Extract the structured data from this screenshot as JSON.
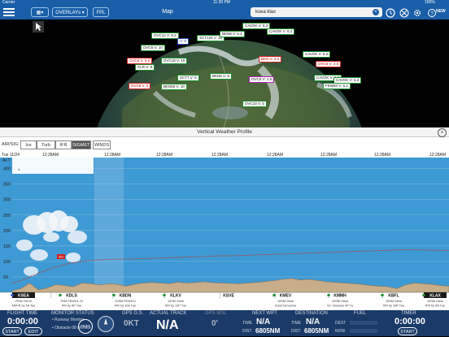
{
  "status_bar": {
    "carrier": "Carrier",
    "time": "11:30 PM",
    "battery": "100%"
  },
  "nav": {
    "overlays_label": "OVERLAYs",
    "fpl_label": "FPL",
    "title": "Map",
    "search_value": "ksea klax",
    "new_badge": "NEW"
  },
  "map": {
    "metars": [
      {
        "text": "OVC12 V: 6.2",
        "cat": "vfr"
      },
      {
        "text": "V: 8",
        "cat": "mvfr"
      },
      {
        "text": "SCT120 V: 10",
        "cat": "vfr"
      },
      {
        "text": "BKN8 V: 5.2",
        "cat": "vfr"
      },
      {
        "text": "CAVOK V: 6.2",
        "cat": "vfr"
      },
      {
        "text": "CAVOK V: 6.2",
        "cat": "vfr"
      },
      {
        "text": "OVC6 V: 10",
        "cat": "vfr"
      },
      {
        "text": "OVC6 V: 6.2",
        "cat": "ifr"
      },
      {
        "text": "OVC18 V: 15",
        "cat": "vfr"
      },
      {
        "text": "BKN V: 3.2",
        "cat": "ifr"
      },
      {
        "text": "CAVOK V: 6.2",
        "cat": "vfr"
      },
      {
        "text": "OVC5 V: 3.0",
        "cat": "ifr"
      },
      {
        "text": "CLR V: 9",
        "cat": "vfr"
      },
      {
        "text": "SCT7 V: 5",
        "cat": "vfr"
      },
      {
        "text": "CAVOK V: 6.2",
        "cat": "vfr"
      },
      {
        "text": "BKN8 V: 8",
        "cat": "vfr"
      },
      {
        "text": "OVC5 V: 1.5",
        "cat": "lifr"
      },
      {
        "text": "CAVOK V: 6.2",
        "cat": "vfr"
      },
      {
        "text": "OVC8 V: 0",
        "cat": "ifr"
      },
      {
        "text": "BKN50 V: 10",
        "cat": "vfr"
      },
      {
        "text": "FEW50 V: 6.2",
        "cat": "vfr"
      },
      {
        "text": "OVC10 V: 5",
        "cat": "vfr"
      }
    ]
  },
  "profile": {
    "title": "Vertical Weather Profile",
    "air_sig_label": "AIR/SIG:",
    "overlays": [
      "Ice",
      "Turb",
      "IFR",
      "SIGMET",
      "WINDS"
    ],
    "active_overlay": "SIGMET",
    "date_label": "Tue 11/24",
    "time_labels": [
      "12:28AM",
      "12:28AM",
      "12:28AM",
      "12:28AM",
      "12:28AM",
      "12:28AM",
      "12:28AM",
      "12:28AM"
    ],
    "alt_label": "ALT",
    "alt_ticks": [
      "400",
      "350",
      "300",
      "250",
      "200",
      "150",
      "100",
      "50"
    ],
    "alt_tick_values": [
      400,
      350,
      300,
      250,
      200,
      150,
      100,
      50
    ],
    "sigmet_marker": "SIG",
    "airports": [
      {
        "id": "KSEA",
        "l1": "FEW OVC6",
        "l2": "MVFR by 1A Tue",
        "color": "#2850d8",
        "boxed": true
      },
      {
        "id": "KDLS",
        "l1": "7NM FEW15, Ol",
        "l2": "IFR by 5P Tue",
        "color": "#1f8f2f",
        "boxed": false
      },
      {
        "id": "KBDN",
        "l1": "10SM FEW110",
        "l2": "IFR by 10A Tue",
        "color": "#1f8f2f",
        "boxed": false
      },
      {
        "id": "KLKV",
        "l1": "10SM Clear",
        "l2": "IFR by 12P Tue",
        "color": "#1f8f2f",
        "boxed": false
      },
      {
        "id": "KSVE",
        "l1": "",
        "l2": "",
        "color": "",
        "boxed": false
      },
      {
        "id": "KMEV",
        "l1": "10SM Clear",
        "l2": "Good tomorrow",
        "color": "#1f8f2f",
        "boxed": false
      },
      {
        "id": "KMMH",
        "l1": "10SM Clear",
        "l2": "VC Showers 4P Tu",
        "color": "#1f8f2f",
        "boxed": false
      },
      {
        "id": "KBFL",
        "l1": "10SM Clear",
        "l2": "IFR by 10P Tue",
        "color": "#1f8f2f",
        "boxed": false
      },
      {
        "id": "KLAX",
        "l1": "10SM Clear",
        "l2": "IFR by 5A Tue",
        "color": "#1f8f2f",
        "boxed": true
      }
    ]
  },
  "chart_data": {
    "type": "area",
    "title": "Vertical Weather Profile",
    "ylabel": "ALT",
    "ylim": [
      0,
      420
    ],
    "y_ticks": [
      50,
      100,
      150,
      200,
      250,
      300,
      350,
      400
    ],
    "x": [
      0,
      2,
      4,
      6,
      8,
      10,
      12,
      14,
      16,
      18,
      20,
      22,
      24,
      26,
      28,
      30,
      32,
      34,
      36,
      38,
      40,
      42,
      44,
      46,
      48,
      50,
      52,
      54,
      56,
      58,
      60,
      62,
      64,
      66,
      68,
      70,
      72,
      74,
      76,
      78,
      80,
      82,
      84,
      86,
      88,
      90,
      92,
      94,
      96,
      98,
      100
    ],
    "series": [
      {
        "values": [
          5,
          12,
          30,
          8,
          14,
          25,
          22,
          18,
          30,
          28,
          24,
          27,
          26,
          20,
          26,
          30,
          32,
          30,
          28,
          33,
          30,
          32,
          34,
          31,
          30,
          29,
          28,
          30,
          32,
          35,
          38,
          42,
          45,
          40,
          42,
          38,
          34,
          32,
          30,
          28,
          26,
          22,
          20,
          18,
          12,
          24,
          30,
          28,
          26,
          22,
          20
        ]
      },
      {
        "values": [
          30,
          38,
          50,
          62,
          72,
          82,
          90,
          96,
          100,
          103,
          105,
          106,
          107,
          108,
          108,
          109,
          110,
          111,
          112,
          113,
          114,
          115,
          116,
          117,
          118,
          118,
          119,
          120,
          121,
          122,
          123,
          124,
          125,
          126,
          127,
          128,
          129,
          130,
          131,
          132,
          133,
          134,
          135,
          136,
          137,
          138,
          138,
          137,
          136,
          136,
          135
        ]
      }
    ],
    "legend": "none"
  },
  "bottom": {
    "flight_time": {
      "label": "FLIGHT TIME",
      "value": "0:00:00",
      "start": "START",
      "edit": "EDIT"
    },
    "monitor": {
      "label": "MONITOR STATUS",
      "test": "TEST",
      "items": [
        "• Runway Monitor",
        "• Obstacle 08 Monitor"
      ]
    },
    "gps_gs": {
      "label": "GPS G.S.",
      "value": "0KT"
    },
    "track": {
      "label": "ACTUAL TRACK",
      "value": "N/A"
    },
    "gps_msl": {
      "label": "GPS MSL",
      "value": "0'"
    },
    "next_wpt": {
      "label": "NEXT WPT",
      "time_label": "TIME",
      "time_value": "N/A",
      "dist_label": "DIST",
      "dist_value": "6805NM"
    },
    "destination": {
      "label": "DESTINATION",
      "time_label": "TIME",
      "time_value": "N/A",
      "dist_label": "DIST",
      "dist_value": "6805NM"
    },
    "fuel": {
      "label": "FUEL",
      "dest_label": "DEST",
      "now_label": "NOW"
    },
    "timer": {
      "label": "TIMER",
      "value": "0:00:00",
      "start": "START"
    }
  }
}
